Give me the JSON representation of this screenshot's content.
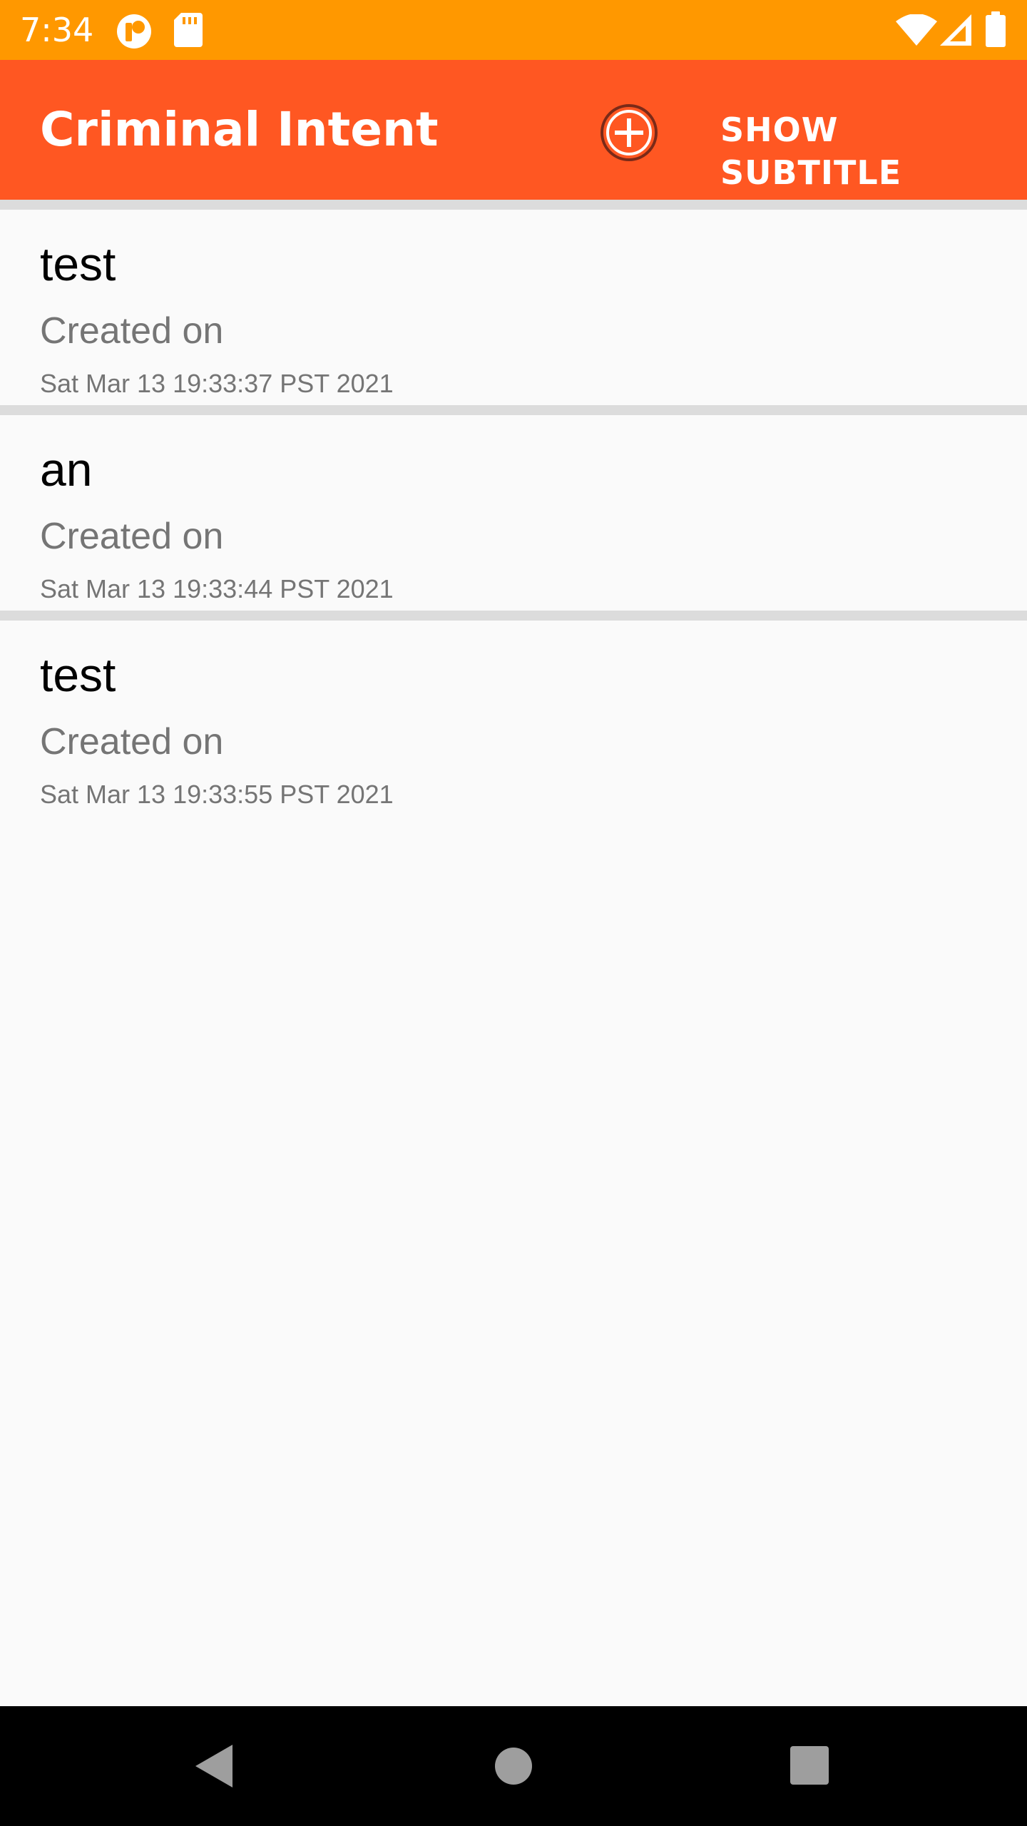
{
  "status_bar": {
    "time": "7:34",
    "icons": [
      "circle-app-icon",
      "sd-card-icon",
      "wifi-icon",
      "signal-icon",
      "battery-icon"
    ],
    "color": "#ff9800"
  },
  "app_bar": {
    "title": "Criminal Intent",
    "add_icon": "add-circle-icon",
    "show_subtitle_label": "SHOW SUBTITLE",
    "color": "#ff5722"
  },
  "crimes": [
    {
      "title": "test",
      "created_label": "Created on",
      "date": "Sat Mar 13 19:33:37 PST 2021"
    },
    {
      "title": "an",
      "created_label": "Created on",
      "date": "Sat Mar 13 19:33:44 PST 2021"
    },
    {
      "title": "test",
      "created_label": "Created on",
      "date": "Sat Mar 13 19:33:55 PST 2021"
    }
  ],
  "nav_bar": {
    "buttons": [
      "back-icon",
      "home-icon",
      "recents-icon"
    ]
  }
}
